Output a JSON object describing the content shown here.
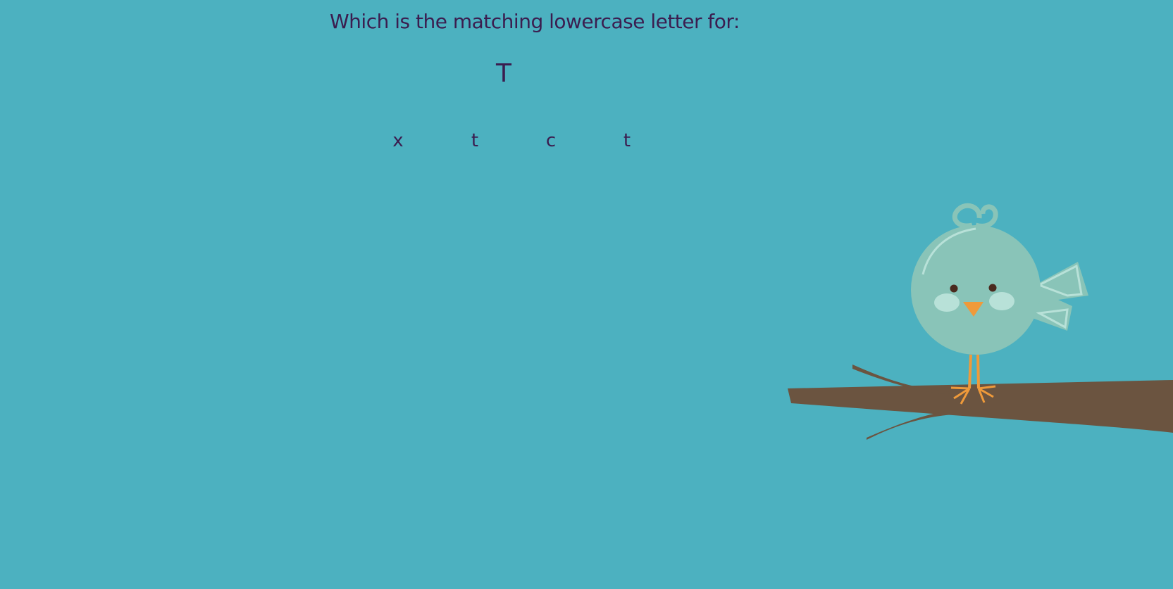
{
  "question": {
    "prompt": "Which is the matching lowercase letter for:",
    "target": "T"
  },
  "choices": [
    {
      "label": "x"
    },
    {
      "label": "t"
    },
    {
      "label": "c"
    },
    {
      "label": "t"
    }
  ],
  "colors": {
    "background": "#4cb1c0",
    "text": "#3b1d4f",
    "bird_body": "#89c4b8",
    "beak_feet": "#ef9a3a",
    "branch": "#6b5440"
  },
  "illustration": {
    "icons": [
      "bird-icon",
      "branch-icon"
    ]
  }
}
